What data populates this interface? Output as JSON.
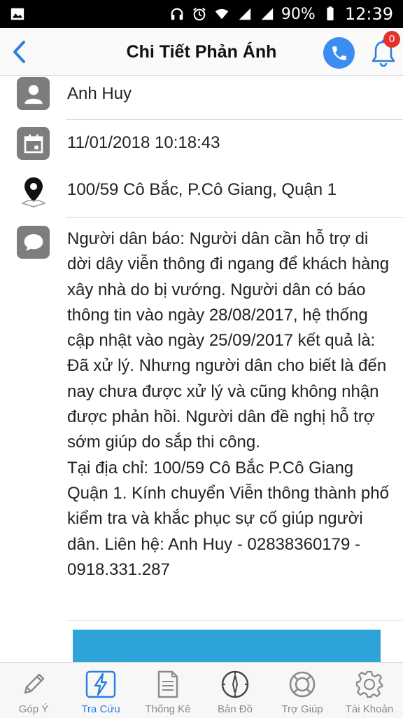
{
  "status_bar": {
    "battery": "90%",
    "time": "12:39",
    "icons": [
      "image-icon",
      "headphones-icon",
      "alarm-icon",
      "wifi-icon",
      "signal-1-icon",
      "signal-2-icon",
      "battery-icon"
    ]
  },
  "header": {
    "title": "Chi Tiết Phản Ánh",
    "notification_count": "0",
    "accent": "#3b8ef0"
  },
  "detail": {
    "name": "Anh Huy",
    "datetime": "11/01/2018 10:18:43",
    "address": "100/59 Cô Bắc, P.Cô Giang, Quận 1",
    "message": "Người dân báo: Người dân cần hỗ trợ di dời dây viễn thông đi ngang để khách hàng xây nhà do bị vướng. Người dân có báo thông tin vào ngày 28/08/2017, hệ thống cập nhật vào ngày 25/09/2017 kết quả là: Đã xử lý. Nhưng người dân cho biết là đến nay chưa được xử lý và cũng không nhận được phản hồi. Người dân đề nghị hỗ trợ sớm giúp do sắp thi công.\nTại địa chỉ: 100/59 Cô Bắc P.Cô Giang Quận 1. Kính chuyển Viễn thông thành phố kiểm tra và khắc phục sự cố giúp người dân. Liên hệ:  Anh Huy - 02838360179 - 0918.331.287"
  },
  "bottom_nav": {
    "items": [
      {
        "label": "Góp Ý",
        "icon": "pencil-icon"
      },
      {
        "label": "Tra Cứu",
        "icon": "lightning-icon"
      },
      {
        "label": "Thống Kê",
        "icon": "document-icon"
      },
      {
        "label": "Bản Đồ",
        "icon": "compass-icon"
      },
      {
        "label": "Trợ Giúp",
        "icon": "lifebuoy-icon"
      },
      {
        "label": "Tài Khoản",
        "icon": "gear-icon"
      }
    ],
    "active_color": "#2b7fe0"
  }
}
